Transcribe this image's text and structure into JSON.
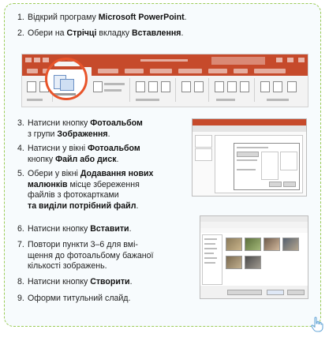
{
  "steps": [
    {
      "num": "1.",
      "lines": [
        [
          {
            "t": "Відкрий програму "
          },
          {
            "t": "Microsoft PowerPoint",
            "b": true
          },
          {
            "t": "."
          }
        ]
      ]
    },
    {
      "num": "2.",
      "lines": [
        [
          {
            "t": "Обери на "
          },
          {
            "t": "Стрічці",
            "b": true
          },
          {
            "t": " вкладку "
          },
          {
            "t": "Вставлення",
            "b": true
          },
          {
            "t": "."
          }
        ]
      ]
    },
    {
      "num": "3.",
      "lines": [
        [
          {
            "t": "Натисни кнопку "
          },
          {
            "t": "Фотоальбом",
            "b": true
          }
        ],
        [
          {
            "t": "з групи "
          },
          {
            "t": "Зображення",
            "b": true
          },
          {
            "t": "."
          }
        ]
      ]
    },
    {
      "num": "4.",
      "lines": [
        [
          {
            "t": "Натисни у вікні "
          },
          {
            "t": "Фотоальбом",
            "b": true
          }
        ],
        [
          {
            "t": "кнопку "
          },
          {
            "t": "Файл або диск",
            "b": true
          },
          {
            "t": "."
          }
        ]
      ]
    },
    {
      "num": "5.",
      "lines": [
        [
          {
            "t": "Обери у вікні "
          },
          {
            "t": "Додавання нових",
            "b": true
          }
        ],
        [
          {
            "t": "малюнків",
            "b": true
          },
          {
            "t": " місце збереження"
          }
        ],
        [
          {
            "t": "файлів з фотокартками"
          }
        ],
        [
          {
            "t": "та виділи потрібний файл",
            "b": true
          },
          {
            "t": "."
          }
        ]
      ]
    },
    {
      "num": "6.",
      "lines": [
        [
          {
            "t": "Натисни кнопку "
          },
          {
            "t": "Вставити",
            "b": true
          },
          {
            "t": "."
          }
        ]
      ]
    },
    {
      "num": "7.",
      "lines": [
        [
          {
            "t": "Повтори пункти 3–6 для вмі-"
          }
        ],
        [
          {
            "t": "щення до фотоальбому бажаної"
          }
        ],
        [
          {
            "t": "кількості зображень."
          }
        ]
      ]
    },
    {
      "num": "8.",
      "lines": [
        [
          {
            "t": "Натисни кнопку "
          },
          {
            "t": "Створити",
            "b": true
          },
          {
            "t": "."
          }
        ]
      ]
    },
    {
      "num": "9.",
      "lines": [
        [
          {
            "t": "Оформи титульний слайд."
          }
        ]
      ]
    }
  ],
  "colors": {
    "border": "#9ccc58",
    "powerpoint_red": "#c64a2b",
    "magnifier_ring": "#e8542a",
    "card_background": "#f7fbfd"
  },
  "icons": [
    "photo-album-icon",
    "hand-pointer-icon"
  ]
}
